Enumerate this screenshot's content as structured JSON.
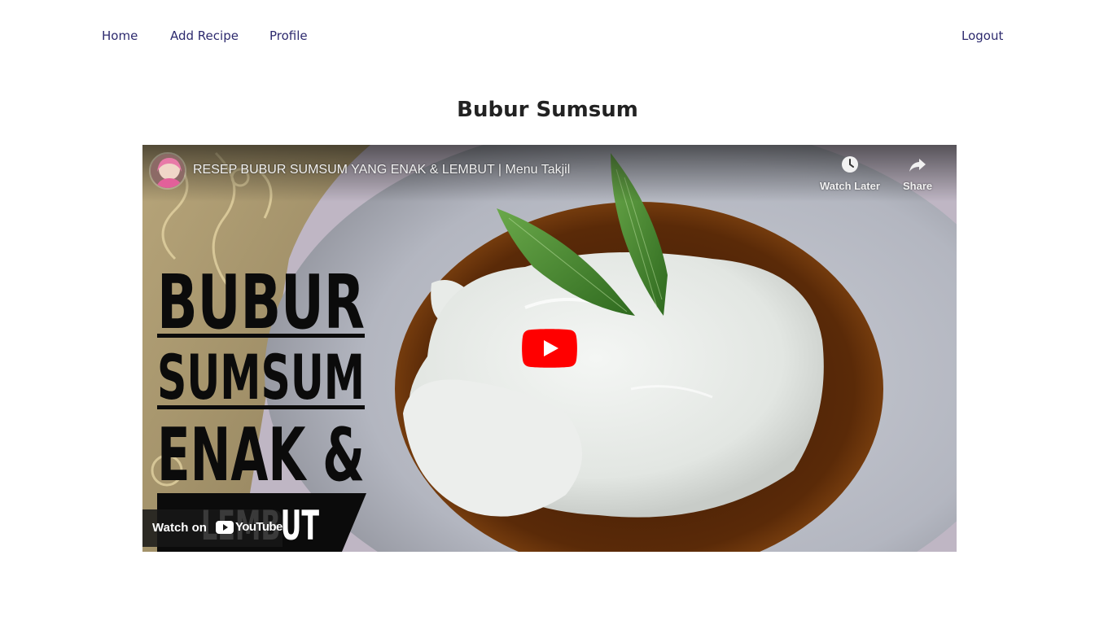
{
  "nav": {
    "home": "Home",
    "add_recipe": "Add Recipe",
    "profile": "Profile",
    "logout": "Logout"
  },
  "recipe": {
    "title": "Bubur Sumsum"
  },
  "video": {
    "title": "RESEP BUBUR SUMSUM YANG ENAK & LEMBUT | Menu Takjil",
    "watch_later": "Watch Later",
    "share": "Share",
    "watch_on": "Watch on",
    "youtube": "YouTube",
    "thumbnail_text": {
      "line1": "BUBUR",
      "line2": "SUMSUM",
      "line3": "ENAK &",
      "line4": "LEMBUT"
    }
  },
  "colors": {
    "nav_link": "#2d2a6e",
    "youtube_red": "#ff0000",
    "syrup": "#5a2a08"
  },
  "icons": {
    "clock": "clock-icon",
    "share": "share-icon",
    "play": "play-icon",
    "youtube_logo": "youtube-logo-icon"
  }
}
